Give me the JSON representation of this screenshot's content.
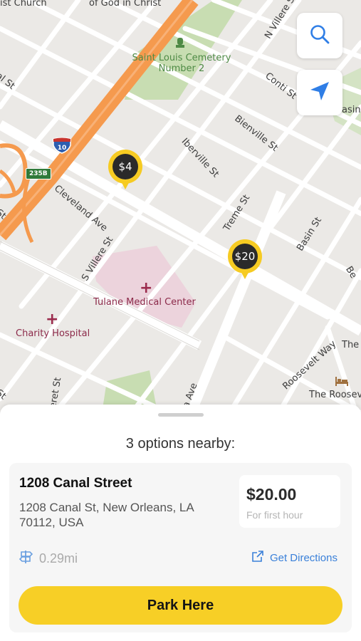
{
  "map": {
    "labels": {
      "church": "ist Church",
      "god": "of God in Christ",
      "cemetery": "Saint Louis Cemetery Number 2",
      "villere_n": "N Villere St",
      "conti": "Conti St",
      "basin_top": "asin",
      "al_st": "al St",
      "bienville": "Bienville St",
      "iberville": "Iberville St",
      "cleveland": "Cleveland Ave",
      "treme": "Treme St",
      "basin": "Basin St",
      "villere_s": "S Villere St",
      "be": "Be",
      "tulane": "Tulane Medical Center",
      "charity": "Charity Hospital",
      "roosevelt": "Roosevelt Way",
      "the": "The",
      "roosev": "The Roosev",
      "st_left": "St",
      "st_left2": "St",
      "eret": "eret St",
      "a_ave": "a Ave"
    },
    "shields": {
      "interstate": "10",
      "exit": "235B"
    },
    "pins": [
      {
        "label": "$4"
      },
      {
        "label": "$20"
      }
    ],
    "buttons": {
      "search_icon": "search-icon",
      "locate_icon": "location-arrow-icon"
    }
  },
  "sheet": {
    "title": "3 options nearby:",
    "result": {
      "name": "1208 Canal Street",
      "address": "1208 Canal St, New Orleans, LA 70112, USA",
      "price": "$20.00",
      "price_note": "For first hour",
      "distance": "0.29mi",
      "directions_label": "Get Directions"
    },
    "cta_label": "Park Here"
  },
  "colors": {
    "accent_yellow": "#f7cf26",
    "link_blue": "#3a80d9",
    "highway_orange": "#f59a4e",
    "map_background": "#ebe9e6"
  }
}
